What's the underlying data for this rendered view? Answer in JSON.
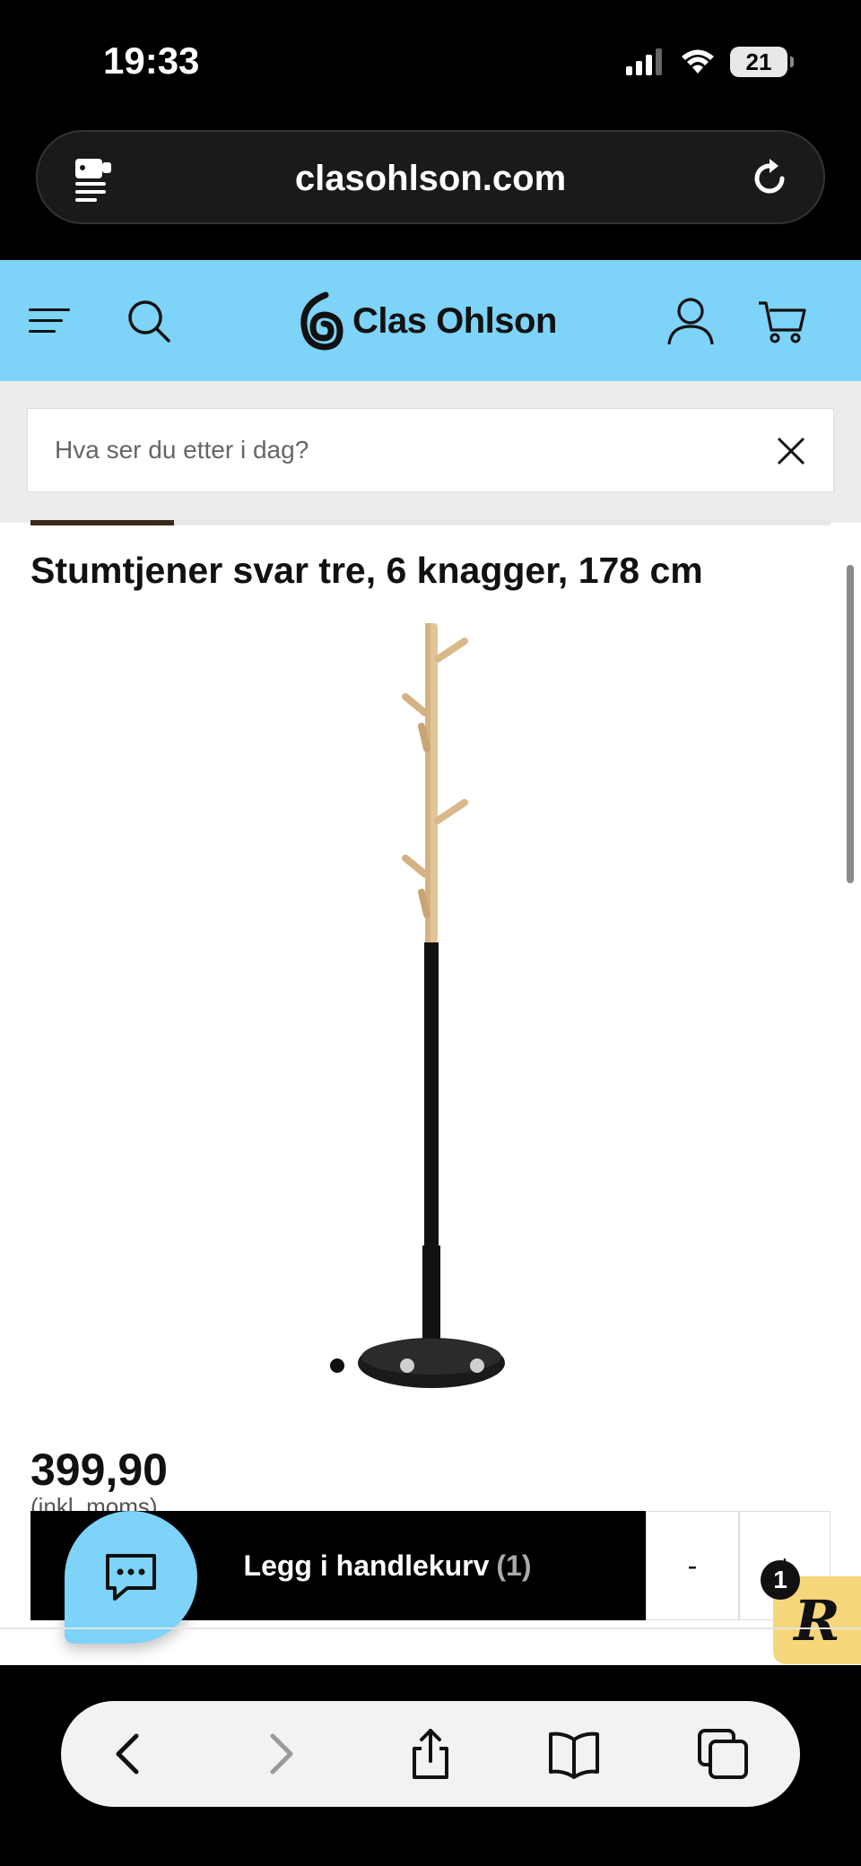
{
  "status_bar": {
    "time": "19:33",
    "battery": "21",
    "signal_icon": "cellular-signal-icon",
    "wifi_icon": "wifi-icon"
  },
  "browser": {
    "url": "clasohlson.com",
    "reader_icon": "reader-mode-icon",
    "reload_icon": "reload-icon"
  },
  "site_header": {
    "brand": "Clas Ohlson",
    "menu_icon": "hamburger-menu-icon",
    "search_icon": "search-icon",
    "account_icon": "user-account-icon",
    "cart_icon": "shopping-cart-icon",
    "background_color": "#7dd3f8"
  },
  "search": {
    "placeholder": "Hva ser du etter i dag?",
    "clear_icon": "close-icon"
  },
  "product": {
    "title": "Stumtjener svar tre, 6 knagger, 178 cm",
    "price": "399,90",
    "price_note": "(inkl. moms)",
    "image_count": 3,
    "active_image": 1
  },
  "cart_bar": {
    "add_label": "Legg i handlekurv",
    "quantity_label": "(1)",
    "minus_label": "-",
    "plus_label": "+"
  },
  "chat": {
    "icon": "chat-bubble-icon"
  },
  "rewards": {
    "letter": "R",
    "count": "1"
  },
  "toolbar": {
    "back_icon": "back-arrow-icon",
    "forward_icon": "forward-arrow-icon",
    "share_icon": "share-icon",
    "bookmarks_icon": "bookmarks-book-icon",
    "tabs_icon": "tabs-icon"
  }
}
